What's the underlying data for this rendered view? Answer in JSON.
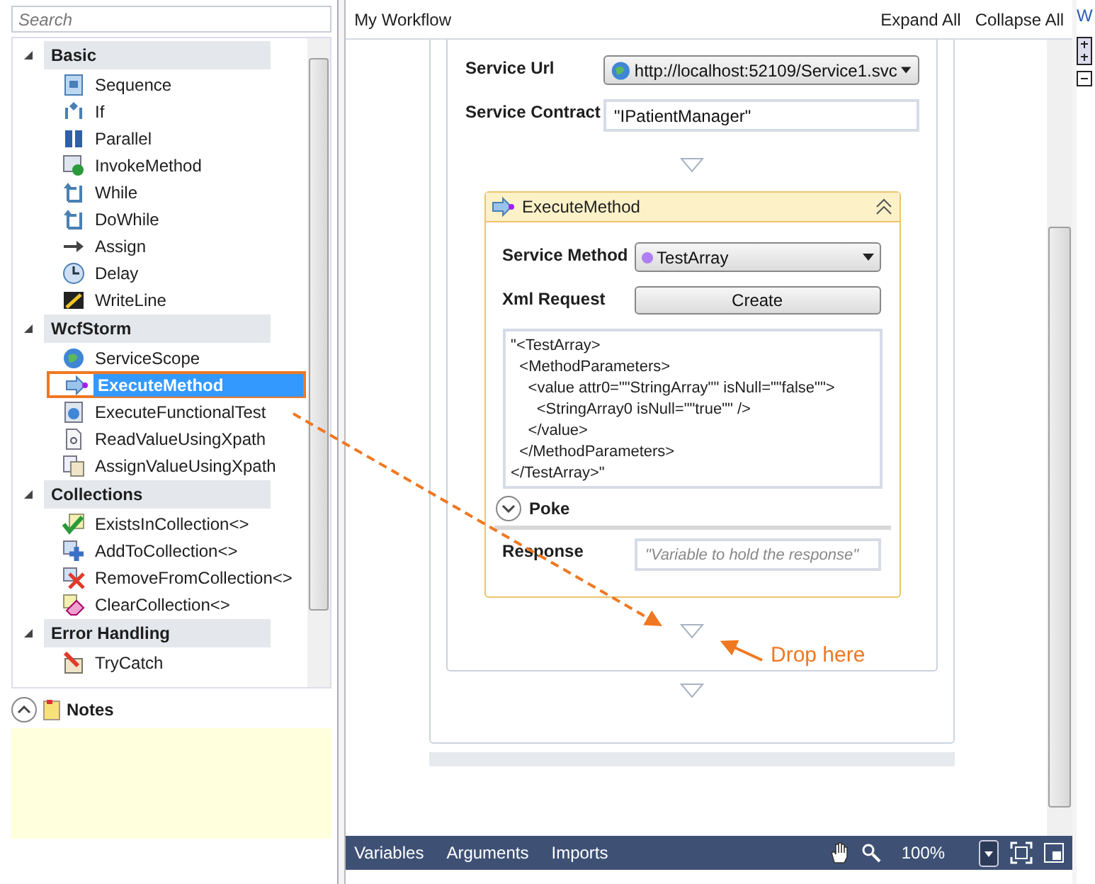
{
  "search": {
    "placeholder": "Search"
  },
  "toolbox": {
    "categories": [
      {
        "name": "Basic",
        "expanded": true,
        "items": [
          {
            "label": "Sequence",
            "kind": "box",
            "selected": false
          },
          {
            "label": "If",
            "kind": "branch",
            "selected": false
          },
          {
            "label": "Parallel",
            "kind": "bars",
            "selected": false
          },
          {
            "label": "InvokeMethod",
            "kind": "play",
            "selected": false
          },
          {
            "label": "While",
            "kind": "loop",
            "selected": false
          },
          {
            "label": "DoWhile",
            "kind": "loop",
            "selected": false
          },
          {
            "label": "Assign",
            "kind": "assign",
            "selected": false
          },
          {
            "label": "Delay",
            "kind": "clock",
            "selected": false
          },
          {
            "label": "WriteLine",
            "kind": "pencil",
            "selected": false
          }
        ]
      },
      {
        "name": "WcfStorm",
        "expanded": true,
        "items": [
          {
            "label": "ServiceScope",
            "kind": "globe",
            "selected": false
          },
          {
            "label": "ExecuteMethod",
            "kind": "arrow",
            "selected": true
          },
          {
            "label": "ExecuteFunctionalTest",
            "kind": "disc",
            "selected": false
          },
          {
            "label": "ReadValueUsingXpath",
            "kind": "doc",
            "selected": false
          },
          {
            "label": "AssignValueUsingXpath",
            "kind": "docs",
            "selected": false
          }
        ]
      },
      {
        "name": "Collections",
        "expanded": true,
        "items": [
          {
            "label": "ExistsInCollection<>",
            "kind": "check",
            "selected": false
          },
          {
            "label": "AddToCollection<>",
            "kind": "plus",
            "selected": false
          },
          {
            "label": "RemoveFromCollection<>",
            "kind": "cross",
            "selected": false
          },
          {
            "label": "ClearCollection<>",
            "kind": "eraser",
            "selected": false
          }
        ]
      },
      {
        "name": "Error Handling",
        "expanded": true,
        "items": [
          {
            "label": "TryCatch",
            "kind": "catch",
            "selected": false
          }
        ]
      }
    ]
  },
  "notes": {
    "title": "Notes",
    "expanded": true
  },
  "designer": {
    "title": "My Workflow",
    "actions": [
      "Expand All",
      "Collapse All"
    ],
    "service_url": {
      "label": "Service Url",
      "value": "http://localhost:52109/Service1.svc"
    },
    "service_contract": {
      "label": "Service Contract",
      "value": "\"IPatientManager\""
    },
    "activity": {
      "title": "ExecuteMethod",
      "expanded": true,
      "service_method": {
        "label": "Service Method",
        "value": "TestArray"
      },
      "xml_request": {
        "label": "Xml Request",
        "button": "Create"
      },
      "xml": "\"<TestArray>\n  <MethodParameters>\n    <value attr0=\"\"StringArray\"\" isNull=\"\"false\"\">\n      <StringArray0 isNull=\"\"true\"\" />\n    </value>\n  </MethodParameters>\n</TestArray>\"",
      "poke": {
        "label": "Poke",
        "expanded": false
      },
      "response": {
        "label": "Response",
        "placeholder": "\"Variable to hold the response\""
      }
    }
  },
  "annotation": "Drop here",
  "bottom_bar": {
    "tabs": [
      "Variables",
      "Arguments",
      "Imports"
    ],
    "zoom": "100%"
  },
  "side_panel": {
    "title": "W"
  }
}
